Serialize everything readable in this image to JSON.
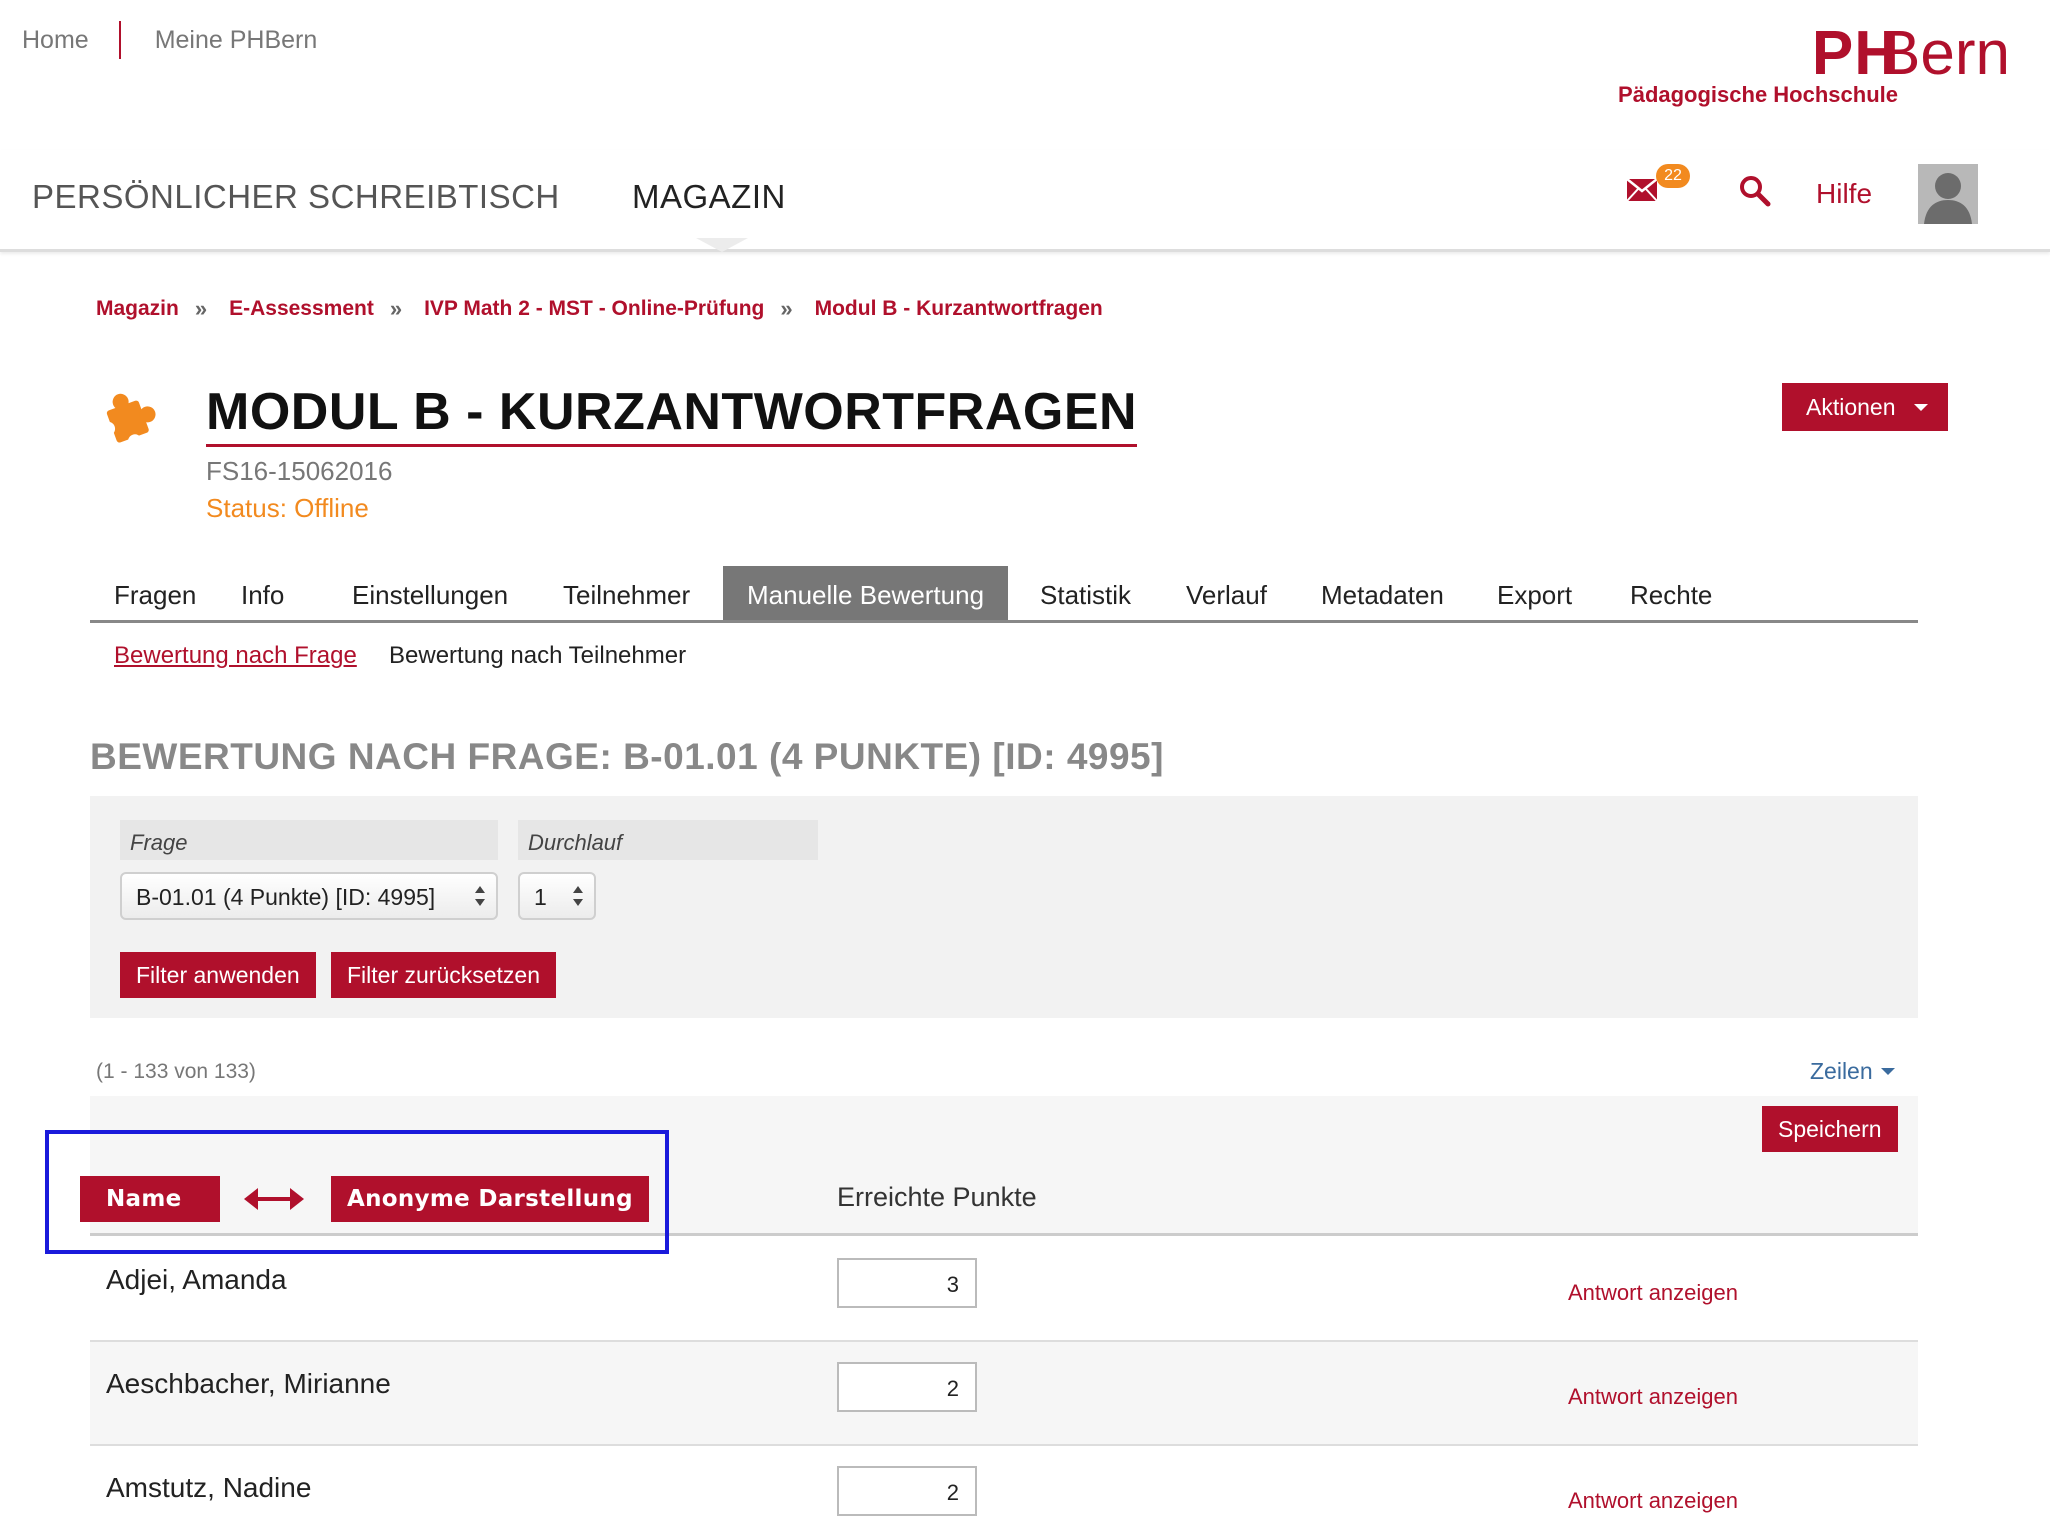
{
  "topnav": {
    "home": "Home",
    "meine": "Meine PHBern"
  },
  "logo": {
    "ph": "PH",
    "bern": "Bern",
    "subtitle": "Pädagogische Hochschule"
  },
  "mainnav": {
    "desk": "PERSÖNLICHER SCHREIBTISCH",
    "magazin": "MAGAZIN"
  },
  "header_right": {
    "mail_count": "22",
    "help": "Hilfe"
  },
  "breadcrumb": [
    "Magazin",
    "E-Assessment",
    "IVP Math 2 - MST - Online-Prüfung",
    "Modul B - Kurzantwortfragen"
  ],
  "breadcrumb_sep": "»",
  "page": {
    "title": "MODUL B - KURZANTWORTFRAGEN",
    "subtitle": "FS16-15062016",
    "status": "Status: Offline",
    "actions_label": "Aktionen"
  },
  "tabs": [
    "Fragen",
    "Info",
    "Einstellungen",
    "Teilnehmer",
    "Manuelle Bewertung",
    "Statistik",
    "Verlauf",
    "Metadaten",
    "Export",
    "Rechte"
  ],
  "active_tab": "Manuelle Bewertung",
  "subtabs": {
    "by_question": "Bewertung nach Frage",
    "by_participant": "Bewertung nach Teilnehmer"
  },
  "section_title": "BEWERTUNG NACH FRAGE: B-01.01 (4 PUNKTE) [ID: 4995]",
  "filter": {
    "frage_label": "Frage",
    "frage_value": "B-01.01 (4 Punkte) [ID: 4995]",
    "durchlauf_label": "Durchlauf",
    "durchlauf_value": "1",
    "apply": "Filter anwenden",
    "reset": "Filter zurücksetzen"
  },
  "table": {
    "count": "(1 - 133 von 133)",
    "rows_label": "Zeilen",
    "save": "Speichern",
    "col_name": "Name",
    "col_anon": "Anonyme Darstellung",
    "col_points": "Erreichte Punkte",
    "rows": [
      {
        "name": "Adjei, Amanda",
        "points": "3",
        "link": "Antwort anzeigen"
      },
      {
        "name": "Aeschbacher, Mirianne",
        "points": "2",
        "link": "Antwort anzeigen"
      },
      {
        "name": "Amstutz, Nadine",
        "points": "2",
        "link": "Antwort anzeigen"
      }
    ]
  },
  "colors": {
    "brand": "#b0102c",
    "status": "#f28a1f",
    "annotation": "#1a1adb"
  }
}
